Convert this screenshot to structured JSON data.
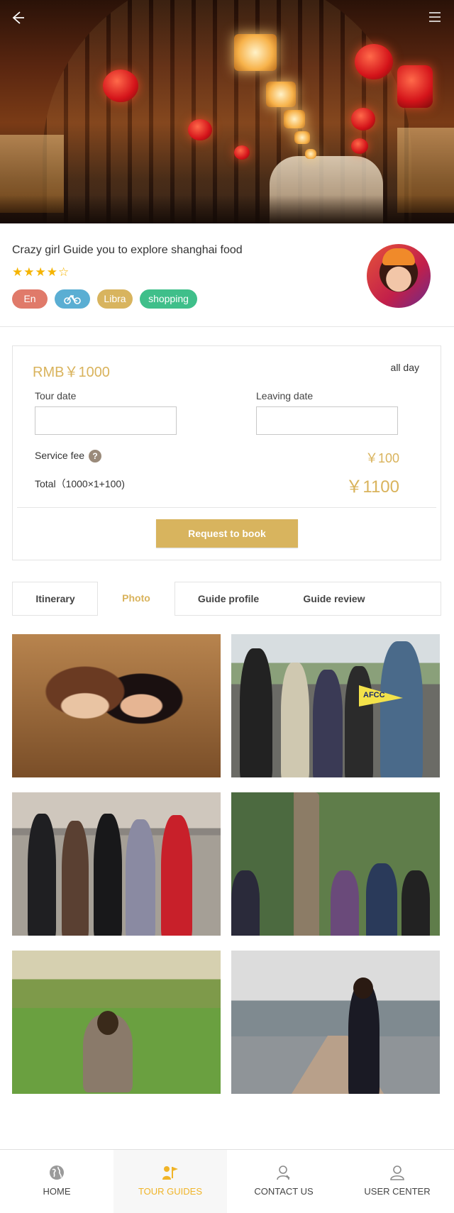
{
  "guide": {
    "title": "Crazy girl Guide you to explore  shanghai  food",
    "stars": "★★★★☆",
    "tags": [
      "En",
      "bike-icon",
      "Libra",
      "shopping"
    ]
  },
  "booking": {
    "price": "RMB￥1000",
    "duration": "all day",
    "tour_date_label": "Tour date",
    "tour_date_value": "",
    "leaving_date_label": "Leaving date",
    "leaving_date_value": "",
    "service_fee_label": "Service fee",
    "service_fee_value": "￥100",
    "total_label": "Total（1000×1+100)",
    "total_value": "￥1100",
    "book_button": "Request to book"
  },
  "tabs": [
    {
      "label": "Itinerary",
      "active": false
    },
    {
      "label": "Photo",
      "active": true
    },
    {
      "label": "Guide profile",
      "active": false
    },
    {
      "label": "Guide review",
      "active": false
    }
  ],
  "photos_sign_text": "AFCC",
  "bottom_nav": [
    {
      "label": "HOME",
      "icon": "globe-icon",
      "active": false
    },
    {
      "label": "TOUR GUIDES",
      "icon": "guide-flag-icon",
      "active": true
    },
    {
      "label": "CONTACT US",
      "icon": "contact-person-icon",
      "active": false
    },
    {
      "label": "USER CENTER",
      "icon": "user-icon",
      "active": false
    }
  ],
  "colors": {
    "accent": "#d8b45e",
    "star": "#f5b400",
    "tab_active": "#d9b35c",
    "nav_active": "#f0b428"
  }
}
